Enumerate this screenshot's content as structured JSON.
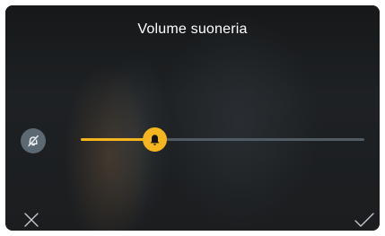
{
  "dialog": {
    "title": "Volume suoneria"
  },
  "volume": {
    "level": 0.26
  },
  "icons": {
    "mute": "bell-off-icon",
    "thumb": "bell-icon",
    "cancel": "close-icon",
    "confirm": "check-icon"
  },
  "colors": {
    "accent": "#f5b51e",
    "track": "#4f5c65",
    "mute_button": "#5c6973"
  }
}
